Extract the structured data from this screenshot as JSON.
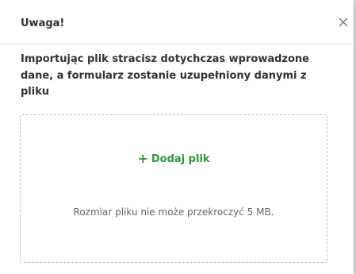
{
  "dialog": {
    "title": "Uwaga!",
    "close_icon": "close-icon",
    "message": "Importując plik stracisz dotychczas wprowadzone dane, a formularz zostanie uzupełniony danymi z pliku"
  },
  "dropzone": {
    "add_icon": "plus-icon",
    "add_label": "Dodaj plik",
    "size_limit_text": "Rozmiar pliku nie może przekroczyć 5 MB."
  },
  "colors": {
    "accent": "#2e9a3a",
    "text": "#333333",
    "muted": "#666666",
    "border": "#bdbdbd"
  }
}
